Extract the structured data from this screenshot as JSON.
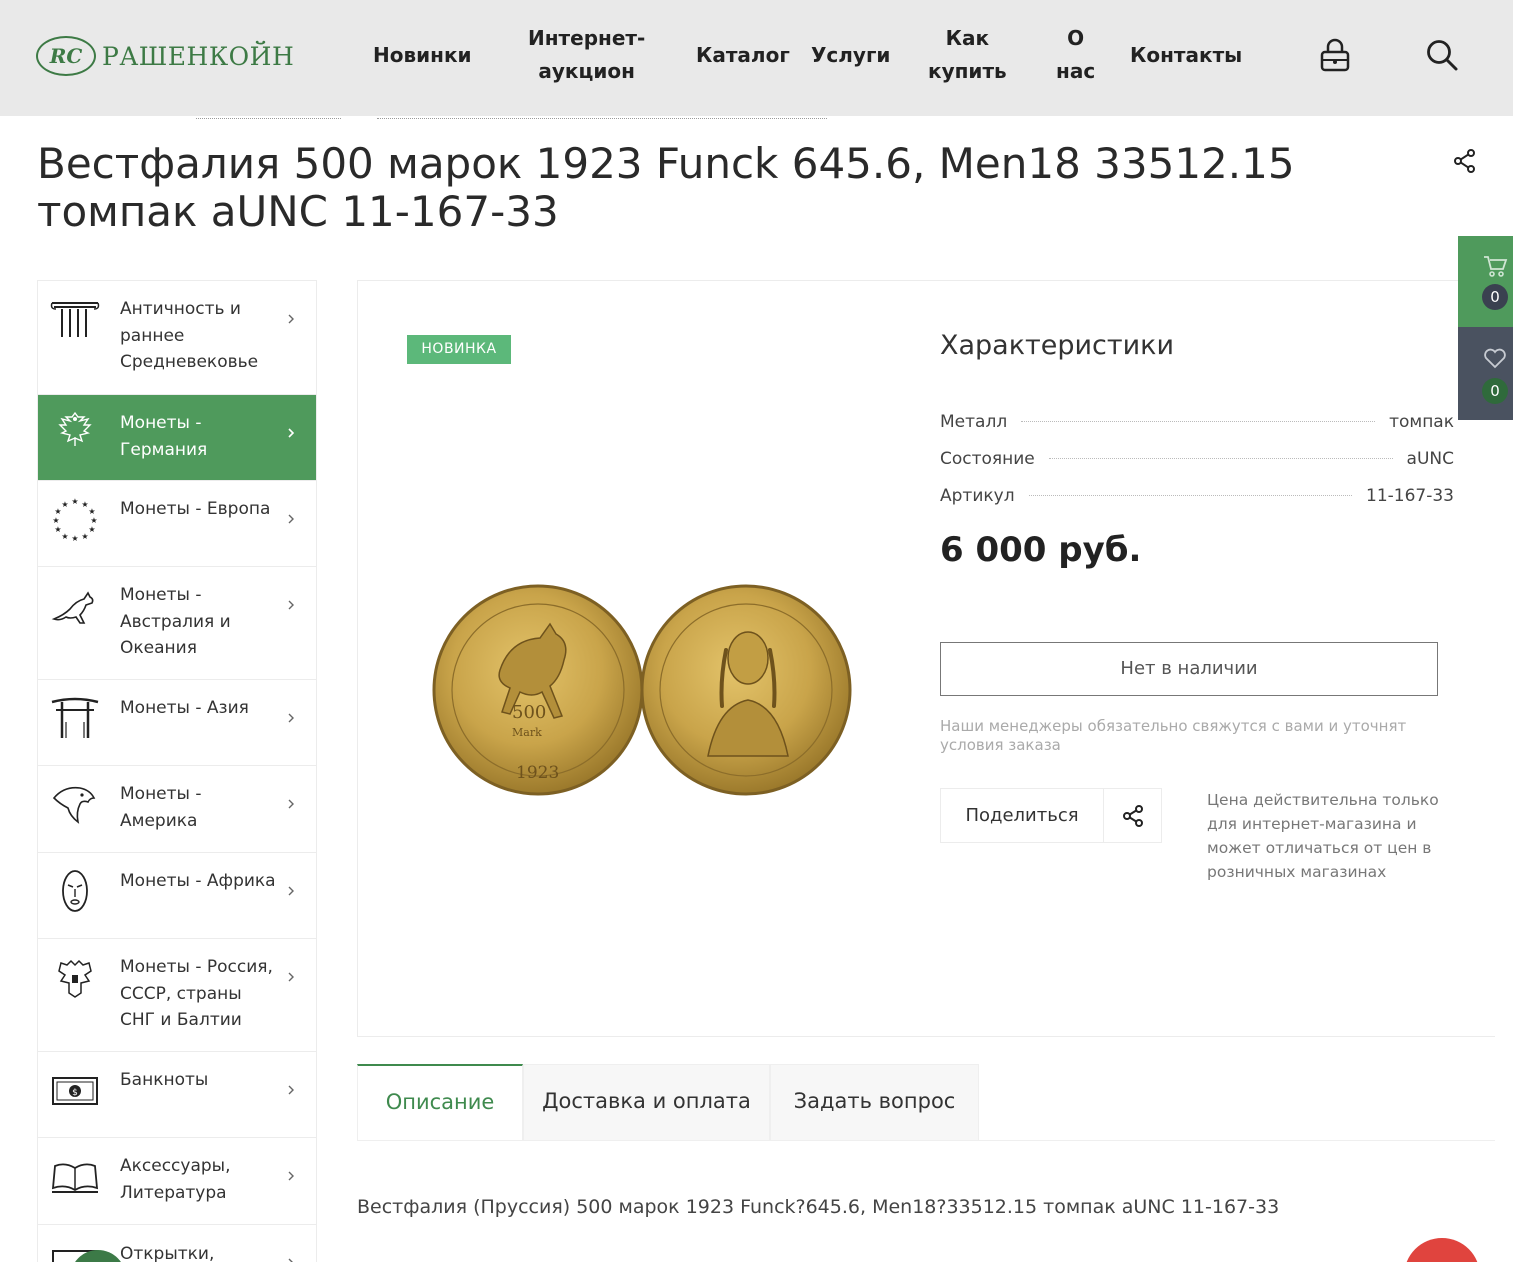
{
  "header": {
    "logo_mark": "RC",
    "logo_text": "РАШЕНКОЙН",
    "nav": [
      {
        "line1": "Новинки",
        "line2": ""
      },
      {
        "line1": "Интернет-",
        "line2": "аукцион"
      },
      {
        "line1": "Каталог",
        "line2": ""
      },
      {
        "line1": "Услуги",
        "line2": ""
      },
      {
        "line1": "Как",
        "line2": "купить"
      },
      {
        "line1": "О",
        "line2": "нас"
      },
      {
        "line1": "Контакты",
        "line2": ""
      }
    ],
    "icons": {
      "account": "lock-icon",
      "search": "search-icon"
    }
  },
  "product": {
    "title": "Вестфалия 500 марок 1923 Funck 645.6, Men18 33512.15 томпак aUNC 11-167-33",
    "badge": "НОВИНКА",
    "characteristics_title": "Характеристики",
    "characteristics": [
      {
        "label": "Металл",
        "value": "томпак"
      },
      {
        "label": "Состояние",
        "value": "aUNC"
      },
      {
        "label": "Артикул",
        "value": "11-167-33"
      }
    ],
    "price": "6 000 руб.",
    "out_of_stock_button": "Нет в наличии",
    "manager_note": "Наши менеджеры обязательно свяжутся с вами и уточнят условия заказа",
    "share_label": "Поделиться",
    "price_note": "Цена действительна только для интернет-магазина и может отличаться от цен в розничных магазинах",
    "coin": {
      "obverse_denomination": "500",
      "obverse_unit": "Mark",
      "obverse_year": "1923"
    }
  },
  "sidebar": {
    "items": [
      {
        "label": "Античность и раннее Средневековье",
        "icon": "column-icon",
        "active": false
      },
      {
        "label": "Монеты - Германия",
        "icon": "eagle-crest-icon",
        "active": true
      },
      {
        "label": "Монеты - Европа",
        "icon": "eu-stars-icon",
        "active": false
      },
      {
        "label": "Монеты - Австралия и Океания",
        "icon": "kangaroo-icon",
        "active": false
      },
      {
        "label": "Монеты - Азия",
        "icon": "torii-gate-icon",
        "active": false
      },
      {
        "label": "Монеты - Америка",
        "icon": "eagle-head-icon",
        "active": false
      },
      {
        "label": "Монеты - Африка",
        "icon": "mask-icon",
        "active": false
      },
      {
        "label": "Монеты - Россия, СССР, страны СНГ и Балтии",
        "icon": "double-eagle-icon",
        "active": false
      },
      {
        "label": "Банкноты",
        "icon": "banknote-icon",
        "active": false
      },
      {
        "label": "Аксессуары, Литература",
        "icon": "book-icon",
        "active": false
      },
      {
        "label": "Открытки,",
        "icon": "postcard-icon",
        "active": false
      }
    ]
  },
  "floating_panel": {
    "cart_count": "0",
    "favorites_count": "0"
  },
  "tabs": [
    {
      "label": "Описание",
      "active": true
    },
    {
      "label": "Доставка и оплата",
      "active": false
    },
    {
      "label": "Задать вопрос",
      "active": false
    }
  ],
  "description": "Вестфалия (Пруссия) 500 марок 1923 Funck?645.6, Men18?33512.15 томпак aUNC 11-167-33",
  "colors": {
    "brand_green": "#4f9a5c",
    "badge_green": "#5cb87a",
    "dark_panel": "#4a5260",
    "header_bg": "#e9e9e9"
  }
}
